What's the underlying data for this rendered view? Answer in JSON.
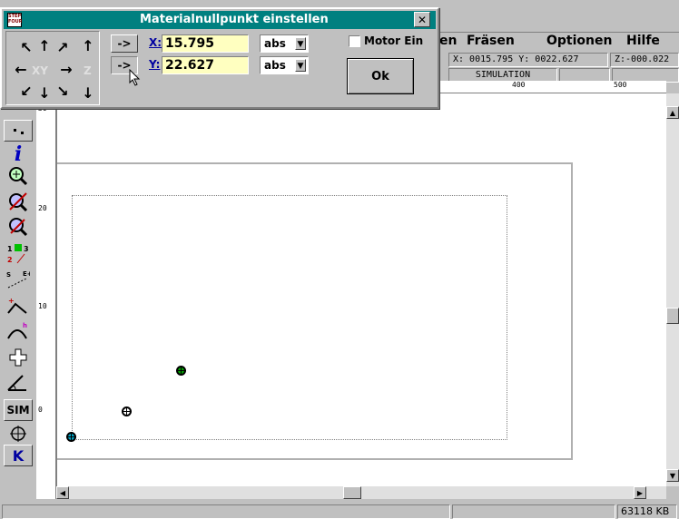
{
  "dialog": {
    "title": "Materialnullpunkt einstellen",
    "close_label": "✕",
    "app_icon_text": "STEP FOUR",
    "arrowpad": {
      "xy_label": "XY",
      "z_label": "Z"
    },
    "set_x_label": "->",
    "set_y_label": "->",
    "x_label": "X:",
    "x_value": "15.795",
    "y_label": "Y:",
    "y_value": "22.627",
    "x_mode": "abs",
    "y_mode": "abs",
    "motor_label": "Motor Ein",
    "ok_label": "Ok"
  },
  "menubar": {
    "items": [
      {
        "label": "en"
      },
      {
        "label": "Fräsen"
      },
      {
        "label": "Optionen"
      },
      {
        "label": "Hilfe"
      }
    ]
  },
  "coords": {
    "xy": "X: 0015.795 Y: 0022.627",
    "z": "Z:-000.022",
    "mode": "SIMULATION"
  },
  "ruler_top": {
    "ticks": [
      "400",
      "500"
    ]
  },
  "ruler_left": {
    "ticks": [
      "30",
      "20",
      "10",
      "0"
    ]
  },
  "statusbar": {
    "memory": "63118 KB"
  },
  "toolbar": {
    "sim_label": "SIM",
    "k_label": "K"
  },
  "colors": {
    "title_bg": "#008080",
    "value_bg": "#ffffc0",
    "canvas_bg": "#ffffff"
  }
}
